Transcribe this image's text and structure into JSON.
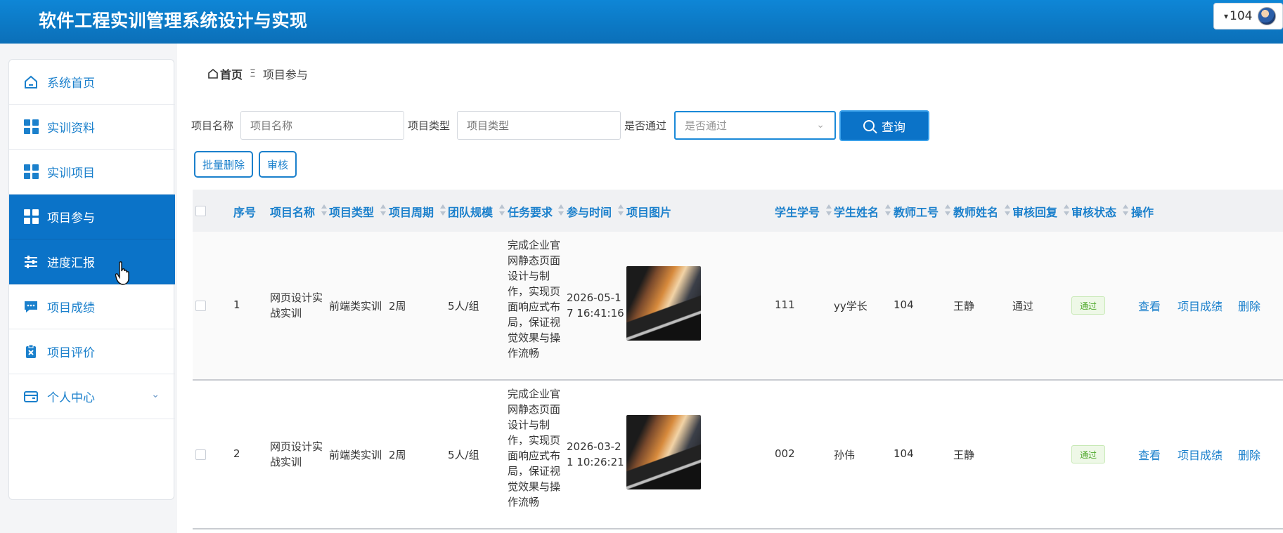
{
  "header": {
    "title": "软件工程实训管理系统设计与实现",
    "user": "104",
    "caret": "▾"
  },
  "sidebar": {
    "items": [
      {
        "label": "系统首页"
      },
      {
        "label": "实训资料"
      },
      {
        "label": "实训项目"
      },
      {
        "label": "项目参与",
        "active": true
      },
      {
        "label": "进度汇报",
        "active": true
      },
      {
        "label": "项目成绩"
      },
      {
        "label": "项目评价"
      },
      {
        "label": "个人中心"
      }
    ]
  },
  "breadcrumb": {
    "home": "首页",
    "separator": "Ξ",
    "current": "项目参与"
  },
  "search": {
    "name_label": "项目名称",
    "name_placeholder": "项目名称",
    "type_label": "项目类型",
    "type_placeholder": "项目类型",
    "passed_label": "是否通过",
    "passed_placeholder": "是否通过",
    "query_label": "查询"
  },
  "toolbar": {
    "batch_delete": "批量删除",
    "review": "审核"
  },
  "table": {
    "headers": [
      "序号",
      "项目名称",
      "项目类型",
      "项目周期",
      "团队规模",
      "任务要求",
      "参与时间",
      "项目图片",
      "学生学号",
      "学生姓名",
      "教师工号",
      "教师姓名",
      "审核回复",
      "审核状态",
      "操作"
    ],
    "rows": [
      {
        "index": "1",
        "name_l1": "网页设计实",
        "name_l2": "战实训",
        "type": "前端类实训",
        "period": "2周",
        "team": "5人/组",
        "task_lines": [
          "完成企业官",
          "网静态页面",
          "设计与制",
          "作，实现页",
          "面响应式布",
          "局，保证视",
          "觉效果与操",
          "作流畅"
        ],
        "time_l1": "2026-05-1",
        "time_l2": "7 16:41:16",
        "student_id": "111",
        "student_name": "yy学长",
        "teacher_id": "104",
        "teacher_name": "王静",
        "reply": "通过",
        "status": "通过",
        "actions": {
          "view": "查看",
          "score": "项目成绩",
          "delete": "删除"
        }
      },
      {
        "index": "2",
        "name_l1": "网页设计实",
        "name_l2": "战实训",
        "type": "前端类实训",
        "period": "2周",
        "team": "5人/组",
        "task_lines": [
          "完成企业官",
          "网静态页面",
          "设计与制",
          "作，实现页",
          "面响应式布",
          "局，保证视",
          "觉效果与操",
          "作流畅"
        ],
        "time_l1": "2026-03-2",
        "time_l2": "1 10:26:21",
        "student_id": "002",
        "student_name": "孙伟",
        "teacher_id": "104",
        "teacher_name": "王静",
        "reply": "",
        "status": "通过",
        "actions": {
          "view": "查看",
          "score": "项目成绩",
          "delete": "删除"
        }
      }
    ]
  }
}
